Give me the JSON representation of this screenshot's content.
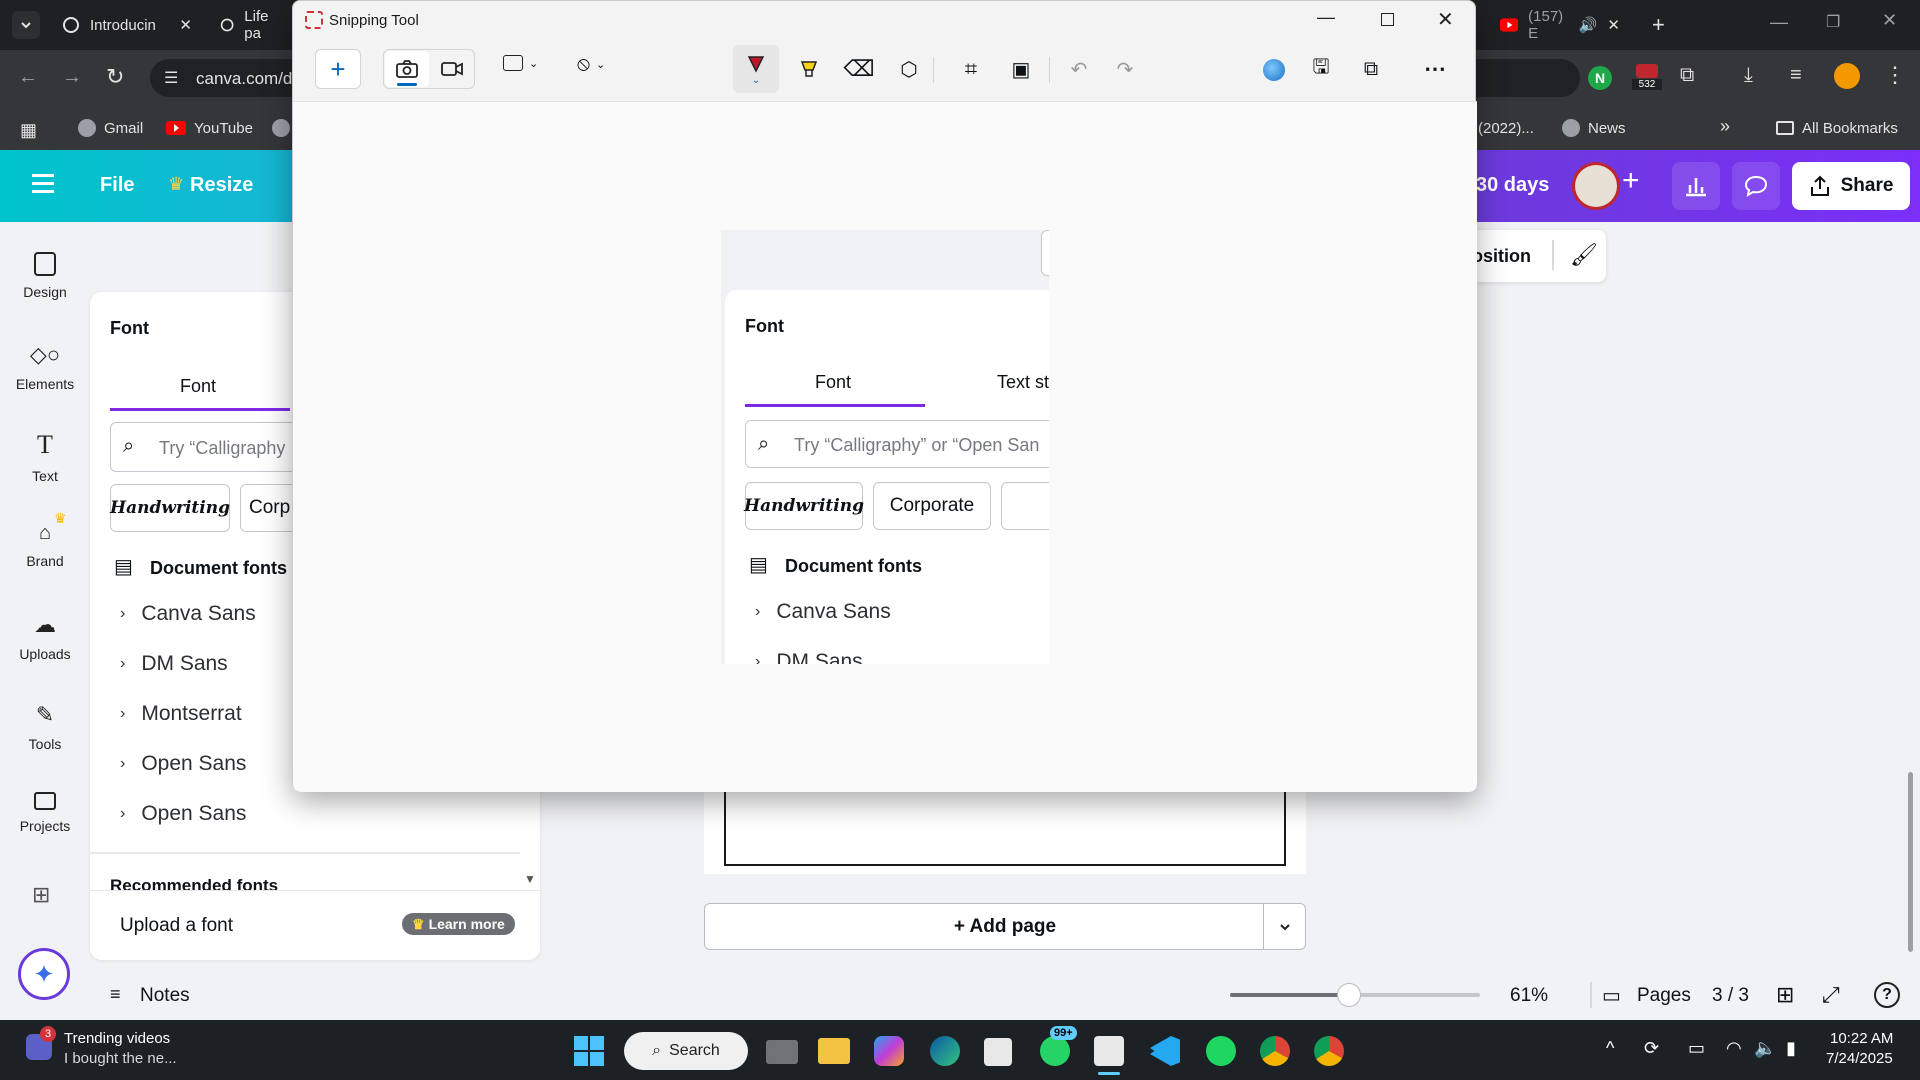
{
  "browser": {
    "tabs": [
      {
        "title": "Introducin"
      },
      {
        "title": "Life pa"
      },
      {
        "title": "(157) E"
      }
    ],
    "address": "canva.com/d",
    "extension_badge": "532",
    "bookmarks": [
      {
        "label": "Gmail"
      },
      {
        "label": "YouTube"
      },
      {
        "label": "(2022)..."
      },
      {
        "label": "News"
      }
    ],
    "all_bookmarks": "All Bookmarks"
  },
  "canva": {
    "header": {
      "file": "File",
      "resize": "Resize",
      "trial": "30 days",
      "share": "Share",
      "position": "osition"
    },
    "rail": [
      {
        "label": "Design"
      },
      {
        "label": "Elements"
      },
      {
        "label": "Text"
      },
      {
        "label": "Brand"
      },
      {
        "label": "Uploads"
      },
      {
        "label": "Tools"
      },
      {
        "label": "Projects"
      }
    ],
    "font_panel": {
      "title": "Font",
      "tab_font": "Font",
      "search_placeholder": "Try “Calligraphy",
      "chips": [
        "Handwriting",
        "Corp"
      ],
      "section": "Document fonts",
      "fonts": [
        "Canva Sans",
        "DM Sans",
        "Montserrat",
        "Open Sans",
        "Open Sans"
      ],
      "recommended": "Recommended fonts",
      "upload": "Upload a font",
      "learn_more": "Learn more"
    },
    "add_page": "+ Add page",
    "bottom": {
      "notes": "Notes",
      "zoom": "61%",
      "pages": "Pages",
      "page_count": "3 / 3"
    }
  },
  "snipping_tool": {
    "title": "Snipping Tool",
    "capture": {
      "title": "Font",
      "tab_font": "Font",
      "tab_text": "Text st",
      "search_placeholder": "Try “Calligraphy” or “Open San",
      "chips": [
        "Handwriting",
        "Corporate"
      ],
      "section": "Document fonts",
      "fonts": [
        "Canva Sans",
        "DM Sans"
      ]
    }
  },
  "taskbar": {
    "news_badge": "3",
    "news_title": "Trending videos",
    "news_sub": "I bought the ne...",
    "search": "Search",
    "whatsapp_badge": "99+",
    "time": "10:22 AM",
    "date": "7/24/2025"
  },
  "colors": {
    "accent_purple": "#7d2ae8",
    "canva_teal": "#00c4cc",
    "youtube_red": "#ff0000"
  }
}
